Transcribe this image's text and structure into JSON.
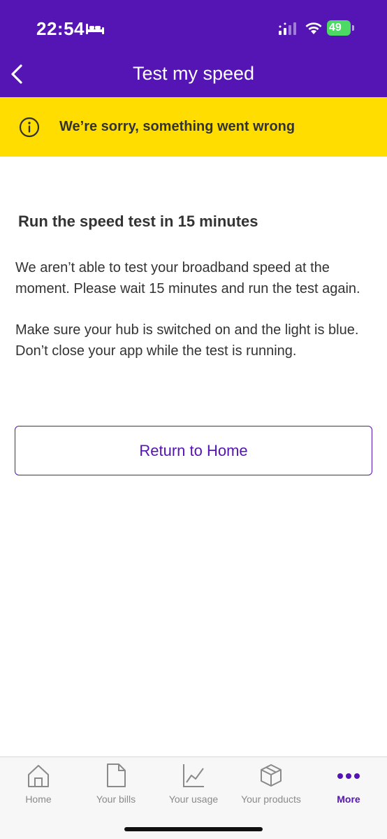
{
  "status_bar": {
    "time": "22:54",
    "battery": "49"
  },
  "header": {
    "title": "Test my speed"
  },
  "banner": {
    "message": "We’re sorry, something went wrong"
  },
  "content": {
    "heading": "Run the speed test in 15 minutes",
    "paragraph_1": "We aren’t able to test your broadband speed at the moment. Please wait 15 minutes and run the test again.",
    "paragraph_2": "Make sure your hub is switched on and the light is blue. Don’t close your app while the test is running."
  },
  "actions": {
    "return_label": "Return to Home"
  },
  "tab_bar": {
    "tabs": [
      {
        "label": "Home",
        "icon": "home-icon"
      },
      {
        "label": "Your bills",
        "icon": "document-icon"
      },
      {
        "label": "Your usage",
        "icon": "chart-icon"
      },
      {
        "label": "Your products",
        "icon": "box-icon"
      },
      {
        "label": "More",
        "icon": "more-icon",
        "active": true
      }
    ]
  },
  "colors": {
    "brand_purple": "#5514b4",
    "banner_yellow": "#ffdd00",
    "battery_green": "#4cd964"
  }
}
